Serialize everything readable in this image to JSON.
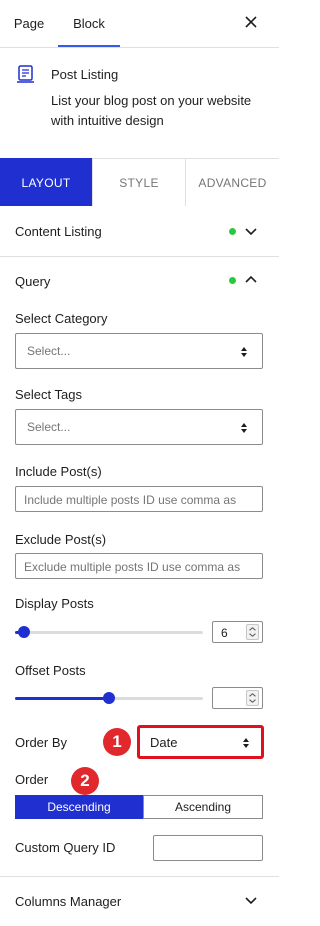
{
  "sidebar_tabs": [
    {
      "label": "Page",
      "active": false
    },
    {
      "label": "Block",
      "active": true
    }
  ],
  "block": {
    "name": "Post Listing",
    "description": "List your blog post on your website with intuitive design",
    "icon": "post-listing-icon"
  },
  "layout_tabs": [
    {
      "label": "LAYOUT",
      "active": true
    },
    {
      "label": "STYLE",
      "active": false
    },
    {
      "label": "ADVANCED",
      "active": false
    }
  ],
  "panels": {
    "content_listing": {
      "title": "Content Listing",
      "expanded": false
    },
    "query": {
      "title": "Query",
      "expanded": true
    },
    "columns_manager": {
      "title": "Columns Manager",
      "expanded": false
    }
  },
  "query": {
    "select_category": {
      "label": "Select Category",
      "value": "Select..."
    },
    "select_tags": {
      "label": "Select Tags",
      "value": "Select..."
    },
    "include_posts": {
      "label": "Include Post(s)",
      "placeholder": "Include multiple posts ID use comma as"
    },
    "exclude_posts": {
      "label": "Exclude Post(s)",
      "placeholder": "Exclude multiple posts ID use comma as"
    },
    "display_posts": {
      "label": "Display Posts",
      "value": "6",
      "slider_fraction": 0.05
    },
    "offset_posts": {
      "label": "Offset Posts",
      "value": "",
      "slider_fraction": 0.5
    },
    "order_by": {
      "label": "Order By",
      "value": "Date"
    },
    "order": {
      "label": "Order",
      "options": [
        "Descending",
        "Ascending"
      ],
      "selected": "Descending"
    },
    "custom_query_id": {
      "label": "Custom Query ID",
      "value": ""
    }
  },
  "annotations": [
    "1",
    "2"
  ],
  "colors": {
    "accent": "#1f2fd0",
    "wp_blue": "#3858e9",
    "status_dot": "#28c93f",
    "highlight": "#e0101c",
    "badge": "#e0282d"
  }
}
